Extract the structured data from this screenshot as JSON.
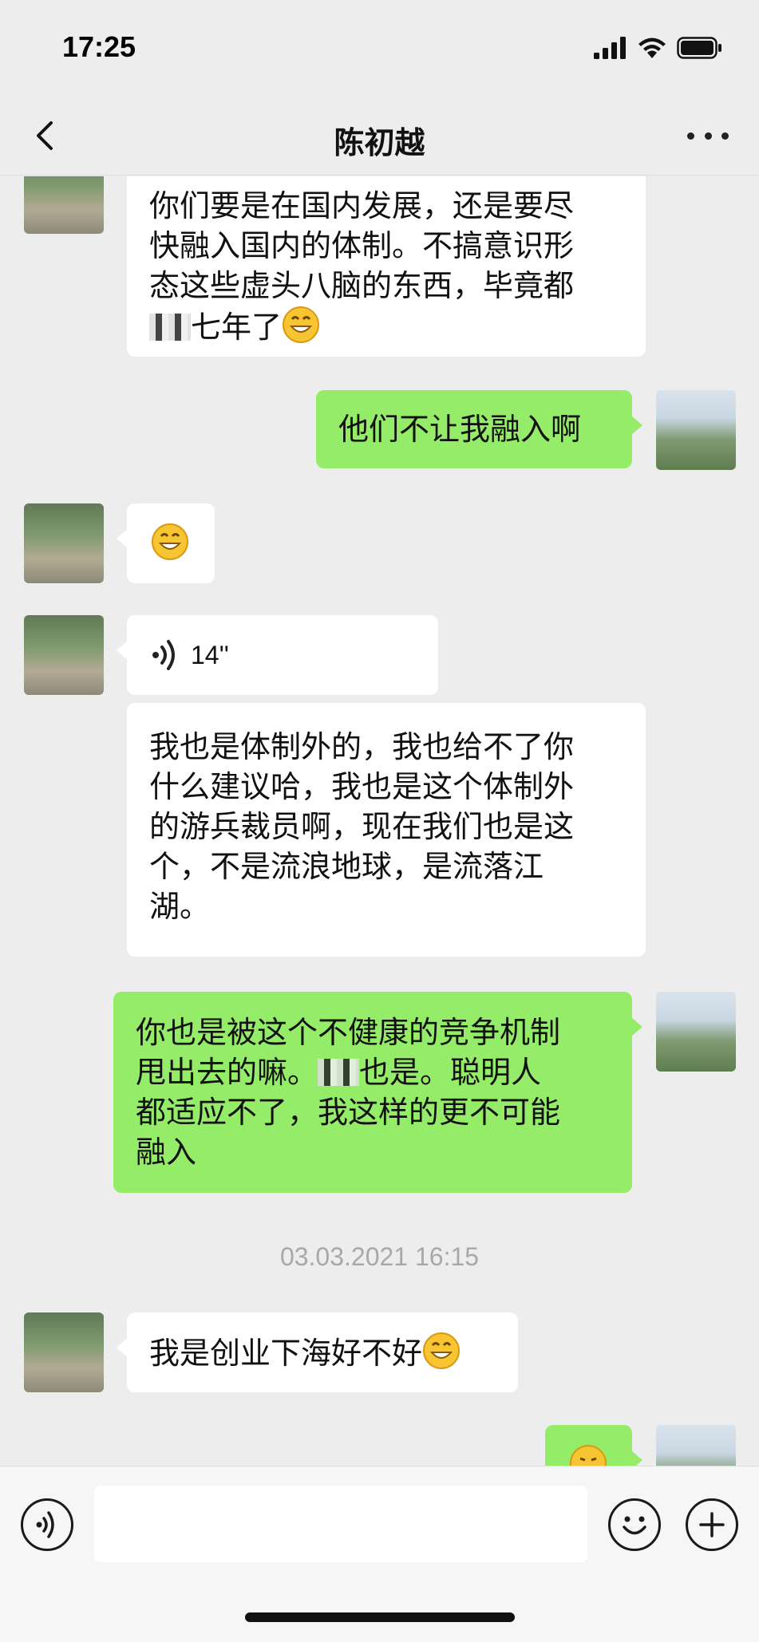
{
  "status_bar": {
    "time": "17:25"
  },
  "header": {
    "title": "陈初越"
  },
  "messages": {
    "m1": {
      "line1": "你们要是在国内发展，还是要尽",
      "line2": "快融入国内的体制。不搞意识形",
      "line3": "态这些虚头八脑的东西，毕竟都",
      "line4": "七年了"
    },
    "m2": {
      "text": "他们不让我融入啊"
    },
    "m4": {
      "duration": "14''"
    },
    "m5": {
      "line1": "我也是体制外的，我也给不了你",
      "line2": "什么建议哈，我也是这个体制外",
      "line3": "的游兵裁员啊，现在我们也是这",
      "line4": "个，不是流浪地球，是流落江",
      "line5": "湖。"
    },
    "m6": {
      "line1": "你也是被这个不健康的竞争机制",
      "line2a": "甩出去的嘛。",
      "line2b": "也是。聪明人",
      "line3": "都适应不了，我这样的更不可能",
      "line4": "融入"
    },
    "timestamp": "03.03.2021 16:15",
    "m7": {
      "text": "我是创业下海好不好"
    }
  },
  "icons": [
    "back-icon",
    "more-icon",
    "voice-icon",
    "emoji-icon",
    "add-icon",
    "grin-emoji-icon",
    "signal-icon",
    "wifi-icon",
    "battery-icon"
  ],
  "colors": {
    "background": "#ededed",
    "bubble_self": "#95ec69",
    "bubble_other": "#ffffff"
  }
}
